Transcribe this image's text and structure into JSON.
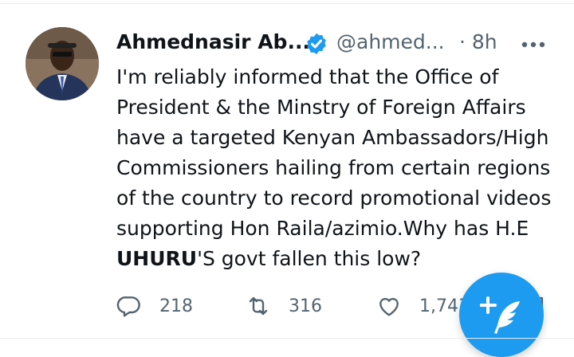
{
  "tweet": {
    "author_name": "Ahmednasir Ab...",
    "handle": "@ahmed...",
    "time": "· 8h",
    "text_before": "I'm reliably informed that the Office of President & the Minstry of Foreign Affairs have a targeted Kenyan Ambassadors/High Commissioners hailing from certain regions of the country to record promotional videos supporting Hon Raila/azimio.Why has H.E ",
    "text_bold": "UHURU",
    "text_after": "'S govt fallen this low?"
  },
  "actions": {
    "replies": "218",
    "retweets": "316",
    "likes": "1,743"
  },
  "icons": {
    "verified": "verified-badge-icon",
    "more": "more-dots-icon",
    "reply": "reply-icon",
    "retweet": "retweet-icon",
    "like": "heart-icon",
    "compose": "compose-tweet-icon",
    "share": "share-icon"
  },
  "colors": {
    "accent": "#1d9bf0",
    "secondary_text": "#536471",
    "primary_text": "#0f1419"
  }
}
